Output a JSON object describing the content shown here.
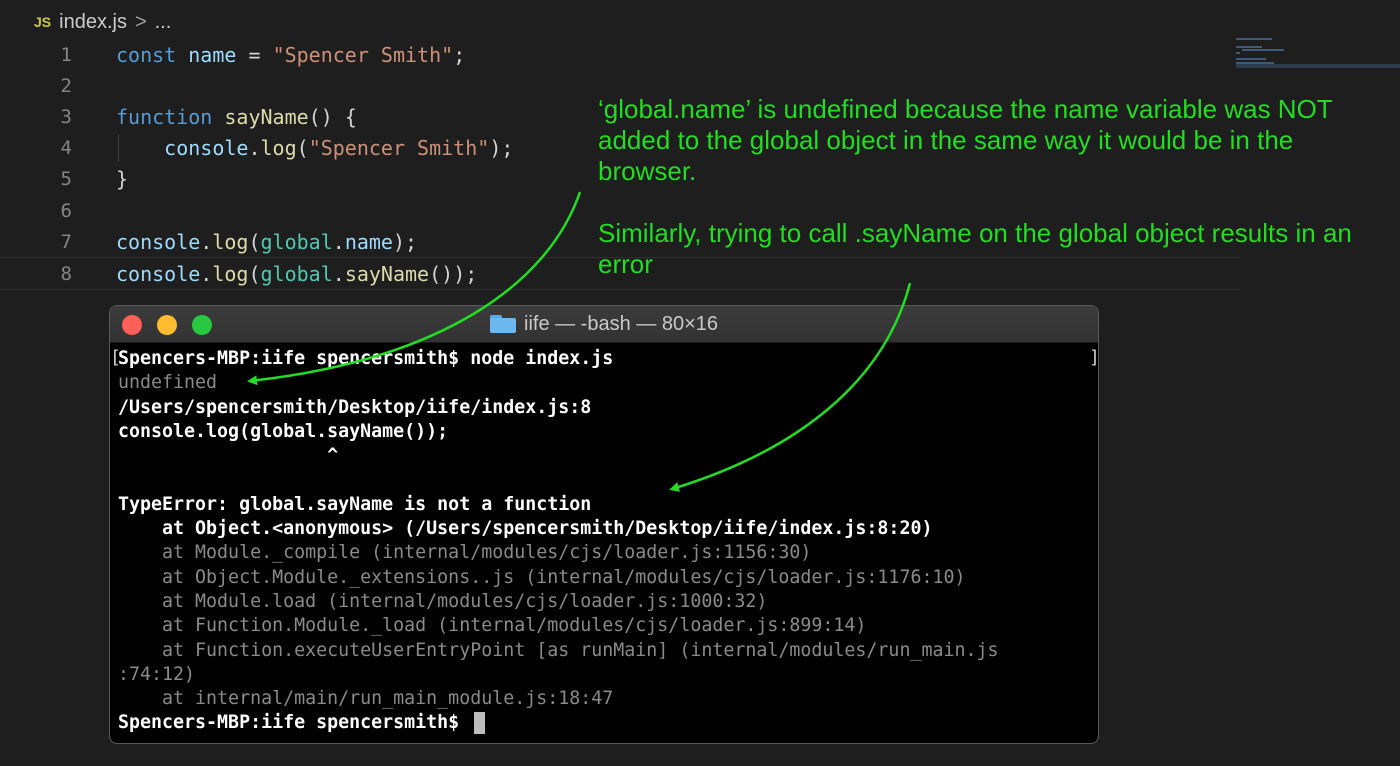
{
  "editor": {
    "breadcrumb": {
      "icon_label": "JS",
      "file": "index.js",
      "separator": ">",
      "more": "..."
    },
    "lines": [
      {
        "no": "1",
        "tokens": [
          {
            "t": "const",
            "c": "kw"
          },
          {
            "t": " ",
            "c": "p"
          },
          {
            "t": "name",
            "c": "var"
          },
          {
            "t": " = ",
            "c": "p"
          },
          {
            "t": "\"Spencer Smith\"",
            "c": "str"
          },
          {
            "t": ";",
            "c": "p"
          }
        ]
      },
      {
        "no": "2",
        "tokens": []
      },
      {
        "no": "3",
        "tokens": [
          {
            "t": "function",
            "c": "kw"
          },
          {
            "t": " ",
            "c": "p"
          },
          {
            "t": "sayName",
            "c": "fn"
          },
          {
            "t": "() {",
            "c": "p"
          }
        ]
      },
      {
        "no": "4",
        "tokens": [
          {
            "t": "    ",
            "c": "p"
          },
          {
            "t": "console",
            "c": "var"
          },
          {
            "t": ".",
            "c": "p"
          },
          {
            "t": "log",
            "c": "fn"
          },
          {
            "t": "(",
            "c": "p"
          },
          {
            "t": "\"Spencer Smith\"",
            "c": "str"
          },
          {
            "t": ");",
            "c": "p"
          }
        ]
      },
      {
        "no": "5",
        "tokens": [
          {
            "t": "}",
            "c": "p"
          }
        ]
      },
      {
        "no": "6",
        "tokens": []
      },
      {
        "no": "7",
        "tokens": [
          {
            "t": "console",
            "c": "var"
          },
          {
            "t": ".",
            "c": "p"
          },
          {
            "t": "log",
            "c": "fn"
          },
          {
            "t": "(",
            "c": "p"
          },
          {
            "t": "global",
            "c": "obj"
          },
          {
            "t": ".",
            "c": "p"
          },
          {
            "t": "name",
            "c": "var"
          },
          {
            "t": ");",
            "c": "p"
          }
        ]
      },
      {
        "no": "8",
        "tokens": [
          {
            "t": "console",
            "c": "var"
          },
          {
            "t": ".",
            "c": "p"
          },
          {
            "t": "log",
            "c": "fn"
          },
          {
            "t": "(",
            "c": "p"
          },
          {
            "t": "global",
            "c": "obj"
          },
          {
            "t": ".",
            "c": "p"
          },
          {
            "t": "sayName",
            "c": "fn"
          },
          {
            "t": "());",
            "c": "p"
          }
        ]
      }
    ]
  },
  "annotation": {
    "paragraph1": "‘global.name’ is undefined because the name variable was NOT added to the global object in the same way it would be in the browser.",
    "paragraph2": "Similarly, trying to call .sayName on the global object results in an error",
    "color": "#22dd22"
  },
  "terminal": {
    "title": "iife — -bash — 80×16",
    "lines": [
      {
        "text": "Spencers-MBP:iife spencersmith$ node index.js",
        "style": "bright"
      },
      {
        "text": "undefined",
        "style": "dim"
      },
      {
        "text": "/Users/spencersmith/Desktop/iife/index.js:8",
        "style": "bright"
      },
      {
        "text": "console.log(global.sayName());",
        "style": "bright"
      },
      {
        "text": "                   ^",
        "style": "bright"
      },
      {
        "text": "",
        "style": "bright"
      },
      {
        "text": "TypeError: global.sayName is not a function",
        "style": "bright"
      },
      {
        "text": "    at Object.<anonymous> (/Users/spencersmith/Desktop/iife/index.js:8:20)",
        "style": "bright"
      },
      {
        "text": "    at Module._compile (internal/modules/cjs/loader.js:1156:30)",
        "style": "dim"
      },
      {
        "text": "    at Object.Module._extensions..js (internal/modules/cjs/loader.js:1176:10)",
        "style": "dim"
      },
      {
        "text": "    at Module.load (internal/modules/cjs/loader.js:1000:32)",
        "style": "dim"
      },
      {
        "text": "    at Function.Module._load (internal/modules/cjs/loader.js:899:14)",
        "style": "dim"
      },
      {
        "text": "    at Function.executeUserEntryPoint [as runMain] (internal/modules/run_main.js",
        "style": "dim"
      },
      {
        "text": ":74:12)",
        "style": "dim"
      },
      {
        "text": "    at internal/main/run_main_module.js:18:47",
        "style": "dim"
      },
      {
        "text": "Spencers-MBP:iife spencersmith$ ",
        "style": "bright",
        "cursor": true
      }
    ],
    "prompt_bracket_left": "[",
    "prompt_bracket_right": "]"
  }
}
